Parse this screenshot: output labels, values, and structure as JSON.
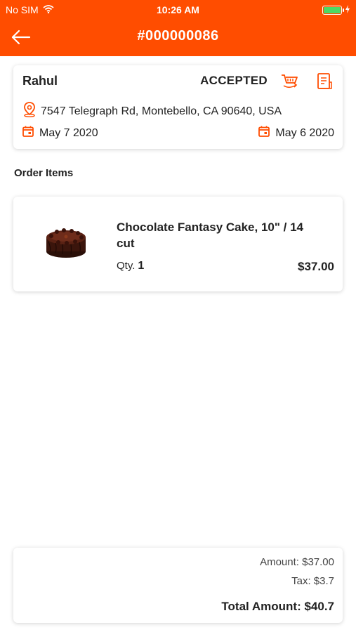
{
  "status_bar": {
    "carrier": "No SIM",
    "time": "10:26 AM"
  },
  "nav": {
    "title": "#000000086"
  },
  "order": {
    "customer_name": "Rahul",
    "status": "ACCEPTED",
    "address": "7547 Telegraph Rd, Montebello, CA 90640, USA",
    "date_left": "May 7 2020",
    "date_right": "May 6 2020"
  },
  "section": {
    "order_items_label": "Order Items"
  },
  "items": [
    {
      "name": "Chocolate Fantasy Cake, 10\" / 14 cut",
      "qty_label": "Qty.",
      "qty": "1",
      "price": "$37.00"
    }
  ],
  "totals": {
    "amount": "Amount: $37.00",
    "tax": "Tax: $3.7",
    "total": "Total Amount: $40.7"
  },
  "colors": {
    "accent": "#ff4d00",
    "battery": "#4cd964"
  },
  "icons": {
    "back": "arrow-left-icon",
    "status_action": "cart-icon",
    "invoice": "invoice-icon",
    "location": "location-pin-icon",
    "calendar": "calendar-icon"
  }
}
